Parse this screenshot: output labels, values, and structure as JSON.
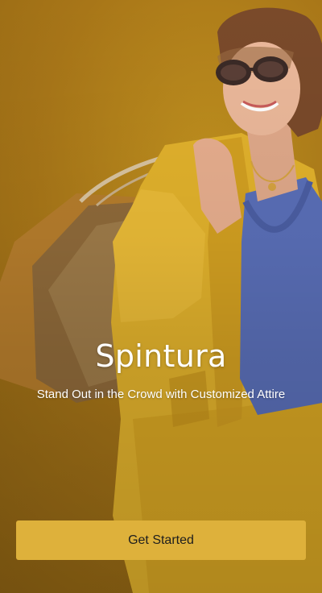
{
  "app": {
    "name": "Spintura",
    "tagline": "Stand Out in the Crowd with Customized Attire"
  },
  "hero": {
    "image_semantic": "woman-in-yellow-suit-with-shopping-bags",
    "background_color": "#a87618"
  },
  "cta": {
    "label": "Get Started",
    "color": "#deb13b",
    "text_color": "#1e1e1e"
  }
}
